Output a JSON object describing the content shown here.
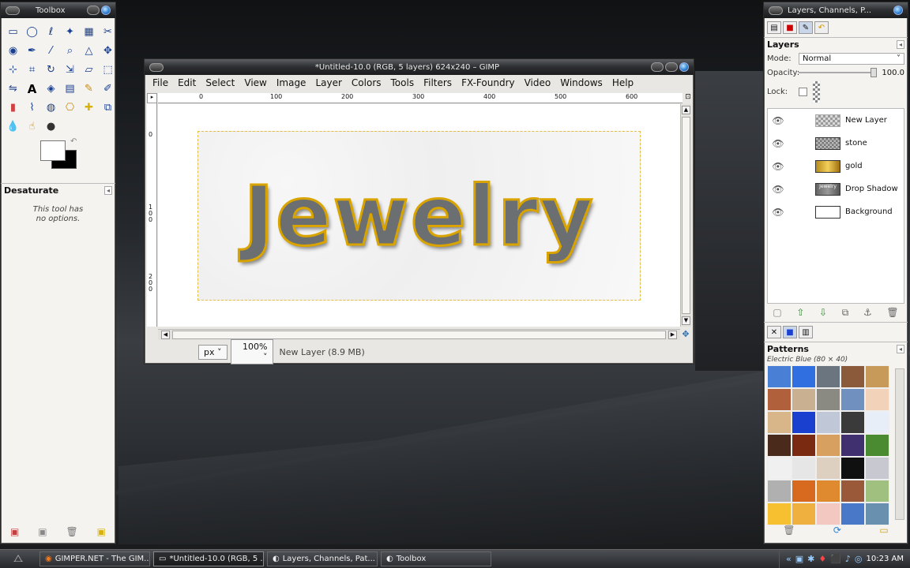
{
  "toolbox": {
    "title": "Toolbox",
    "tools": [
      "rect-select",
      "ellipse-select",
      "free-select",
      "fuzzy-select",
      "select-by-color",
      "scissors",
      "foreground-select",
      "paths",
      "color-picker",
      "zoom",
      "measure",
      "move",
      "align",
      "crop",
      "rotate",
      "scale",
      "shear",
      "perspective",
      "flip",
      "text",
      "bucket-fill",
      "blend",
      "pencil",
      "paintbrush",
      "eraser",
      "airbrush",
      "ink",
      "clone",
      "heal",
      "perspective-clone",
      "blur",
      "smudge",
      "dodge"
    ],
    "tool_options_title": "Desaturate",
    "tool_options_note_line1": "This tool has",
    "tool_options_note_line2": "no options."
  },
  "image_window": {
    "title": "*Untitled-10.0 (RGB, 5 layers) 624x240 – GIMP",
    "menu": [
      "File",
      "Edit",
      "Select",
      "View",
      "Image",
      "Layer",
      "Colors",
      "Tools",
      "Filters",
      "FX-Foundry",
      "Video",
      "Windows",
      "Help"
    ],
    "ruler_h": [
      "0",
      "100",
      "200",
      "300",
      "400",
      "500",
      "600"
    ],
    "ruler_v": [
      "0",
      "1 0 0",
      "2 0 0"
    ],
    "canvas_text": "Jewelry",
    "status": {
      "unit": "px",
      "zoom": "100%",
      "layer_info": "New Layer (8.9 MB)"
    }
  },
  "layers_window": {
    "title": "Layers, Channels, P...",
    "dock_title": "Layers",
    "mode_label": "Mode:",
    "mode_value": "Normal",
    "opacity_label": "Opacity:",
    "opacity_value": "100.0",
    "opacity_fraction": 1.0,
    "lock_label": "Lock:",
    "layers": [
      {
        "name": "New Layer",
        "thumb": "checker"
      },
      {
        "name": "stone",
        "thumb": "stone"
      },
      {
        "name": "gold",
        "thumb": "gold"
      },
      {
        "name": "Drop Shadow",
        "thumb": "shadow",
        "thumb_text": "Jewelry"
      },
      {
        "name": "Background",
        "thumb": "white"
      }
    ],
    "patterns_title": "Patterns",
    "pattern_selected": "Electric Blue (80 × 40)",
    "pattern_colors": [
      "#4a7fd6",
      "#2f6fe0",
      "#6a7580",
      "#8a5a3a",
      "#c79a5a",
      "#b0603a",
      "#c8b090",
      "#8a8a82",
      "#7090c0",
      "#f2d2b8",
      "#d8b68a",
      "#1a40d0",
      "#c0c8d8",
      "#3a3a3a",
      "#e8eef8",
      "#4a2a1a",
      "#7a2a10",
      "#d8a060",
      "#403070",
      "#4a8a30",
      "#f0f0f0",
      "#e6e6e6",
      "#ddd0c0",
      "#101010",
      "#c8c8d0",
      "#b0b0b0",
      "#d86a20",
      "#e08a30",
      "#9a5a3a",
      "#a0c080",
      "#f6c030",
      "#f0b040",
      "#f2c8c0",
      "#4a78c8",
      "#6a90b0"
    ]
  },
  "taskbar": {
    "items": [
      {
        "label": "GIMPER.NET - The GIM...",
        "active": false
      },
      {
        "label": "*Untitled-10.0 (RGB, 5 ...",
        "active": true
      },
      {
        "label": "Layers, Channels, Pat...",
        "active": false
      },
      {
        "label": "Toolbox",
        "active": false
      }
    ],
    "clock": "10:23 AM"
  }
}
